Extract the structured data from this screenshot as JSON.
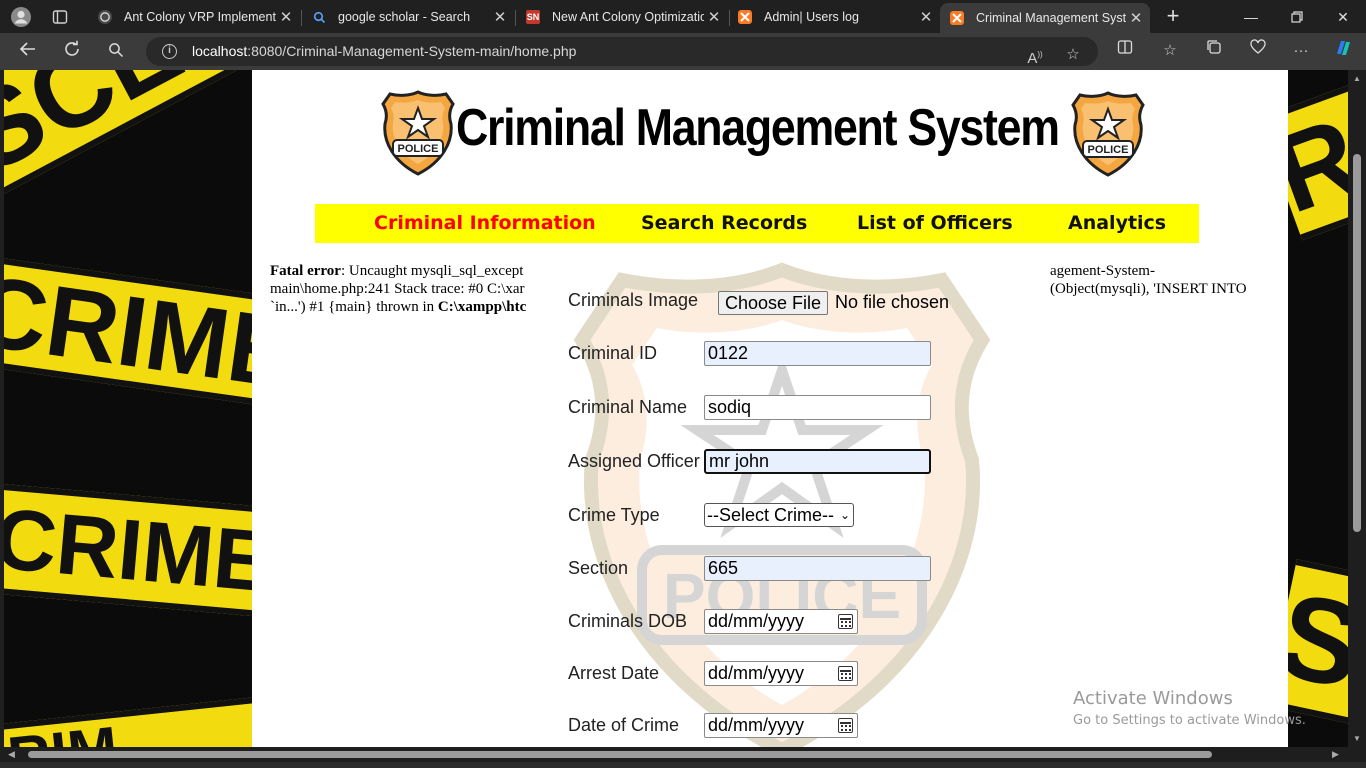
{
  "browser": {
    "tabs": [
      {
        "title": "Ant Colony VRP Implementa",
        "icon": "chatgpt-icon",
        "active": false
      },
      {
        "title": "google scholar - Search",
        "icon": "search-icon",
        "active": false
      },
      {
        "title": "New Ant Colony Optimizatio",
        "icon": "springer-nature-icon",
        "favicon_text": "SN",
        "active": false
      },
      {
        "title": "Admin| Users log",
        "icon": "xampp-icon",
        "active": false
      },
      {
        "title": "Criminal Management Syste",
        "icon": "xampp-icon",
        "active": true
      }
    ],
    "url_host": "localhost",
    "url_path": ":8080/Criminal-Management-System-main/home.php"
  },
  "site": {
    "title": "Criminal Management System",
    "badge_text": "POLICE",
    "nav": [
      {
        "label": "Criminal Information",
        "active": true
      },
      {
        "label": "Search Records",
        "active": false
      },
      {
        "label": "List of Officers",
        "active": false
      },
      {
        "label": "Analytics",
        "active": false
      }
    ],
    "watermark_text": "POLICE"
  },
  "error": {
    "label": "Fatal error",
    "left_line1": ": Uncaught mysqli_sql_except",
    "left_line2": "main\\home.php:241 Stack trace: #0 C:\\xar",
    "left_line3": "`in...') #1 {main} thrown in ",
    "left_line3_bold": "C:\\xampp\\htc",
    "right_line1": "agement-System-",
    "right_line2": "(Object(mysqli), 'INSERT INTO"
  },
  "form": {
    "image_label": "Criminals Image",
    "file_button": "Choose File",
    "file_status": "No file chosen",
    "id_label": "Criminal ID",
    "id_value": "0122",
    "name_label": "Criminal Name",
    "name_value": "sodiq",
    "officer_label": "Assigned Officer",
    "officer_value": "mr john",
    "crime_label": "Crime Type",
    "crime_value": "--Select Crime--",
    "section_label": "Section",
    "section_value": "665",
    "dob_label": "Criminals DOB",
    "dob_value": "dd/mm/yyyy",
    "arrest_label": "Arrest Date",
    "arrest_value": "dd/mm/yyyy",
    "crime_date_label": "Date of Crime",
    "crime_date_value": "dd/mm/yyyy"
  },
  "background_tape": [
    "SCEN",
    "CRIME",
    "CRIME SC",
    "CRIM",
    "RIM",
    "S"
  ],
  "windows_notice": {
    "line1": "Activate Windows",
    "line2": "Go to Settings to activate Windows."
  },
  "colors": {
    "nav_bg": "#ffff00",
    "nav_active": "#ff0000",
    "tape_yellow": "#f2dc10",
    "autofill_blue": "#e8f0fe"
  }
}
